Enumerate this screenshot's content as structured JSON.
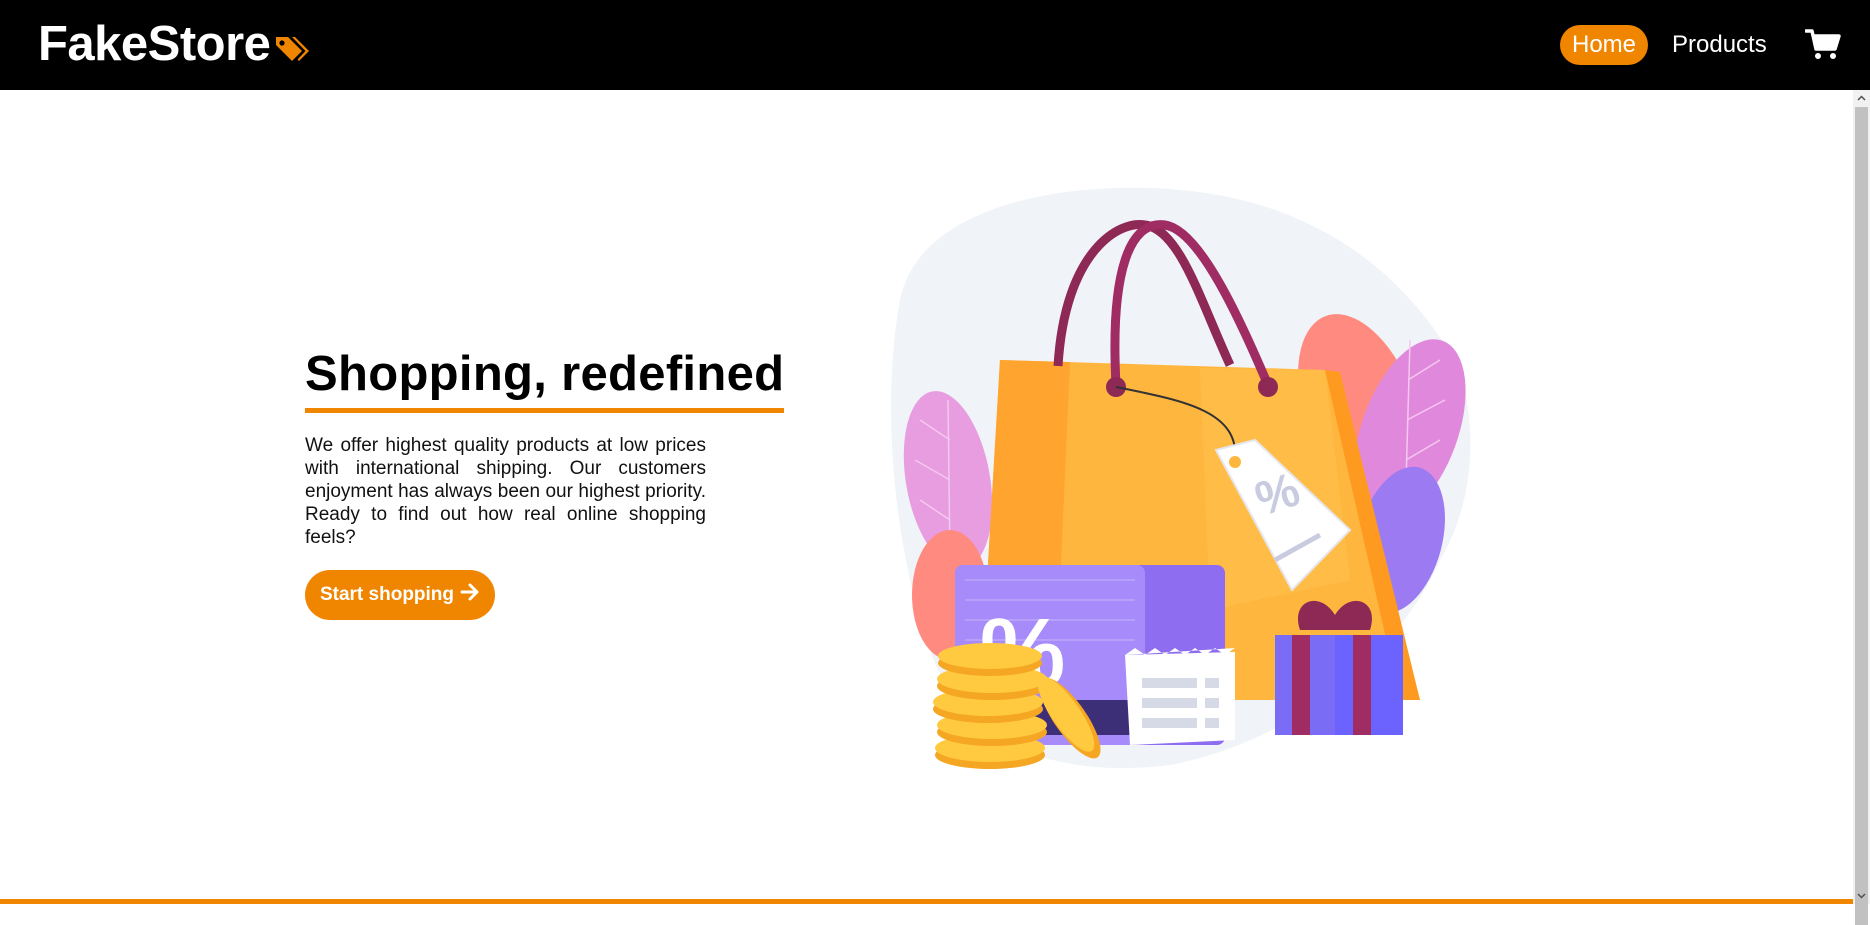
{
  "colors": {
    "accent": "#f08500",
    "navbar": "#000000",
    "text": "#111111"
  },
  "navbar": {
    "brand": "FakeStore",
    "brand_icon": "tags-icon",
    "links": [
      {
        "label": "Home",
        "active": true
      },
      {
        "label": "Products",
        "active": false
      }
    ],
    "cart_icon": "shopping-cart-icon"
  },
  "hero": {
    "title": "Shopping, redefined",
    "description": "We offer highest quality products at low prices with international shipping. Our customers enjoyment has always been our highest priority. Ready to find out how real online shopping feels?",
    "cta_label": "Start shopping",
    "cta_icon": "arrow-right-icon",
    "illustration": "shopping-bag-illustration"
  }
}
